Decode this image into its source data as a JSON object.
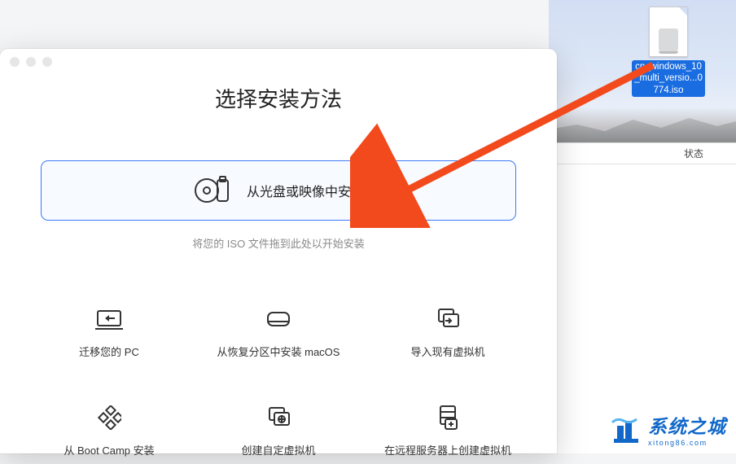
{
  "desktop": {
    "file_label": "cn_windows_10_multi_versio...0774.iso"
  },
  "right_panel": {
    "col_status": "状态"
  },
  "dialog": {
    "title": "选择安装方法",
    "primary": {
      "label": "从光盘或映像中安装",
      "icon": "disc-usb-icon"
    },
    "hint": "将您的 ISO 文件拖到此处以开始安装",
    "options": [
      {
        "icon": "migrate-pc-icon",
        "label": "迁移您的 PC"
      },
      {
        "icon": "recovery-icon",
        "label": "从恢复分区中安装 macOS"
      },
      {
        "icon": "import-vm-icon",
        "label": "导入现有虚拟机"
      },
      {
        "icon": "bootcamp-icon",
        "label": "从 Boot Camp 安装"
      },
      {
        "icon": "custom-vm-icon",
        "label": "创建自定虚拟机"
      },
      {
        "icon": "remote-vm-icon",
        "label": "在远程服务器上创建虚拟机"
      }
    ]
  },
  "watermark": {
    "cn": "系统之城",
    "url": "xitong86.com"
  }
}
